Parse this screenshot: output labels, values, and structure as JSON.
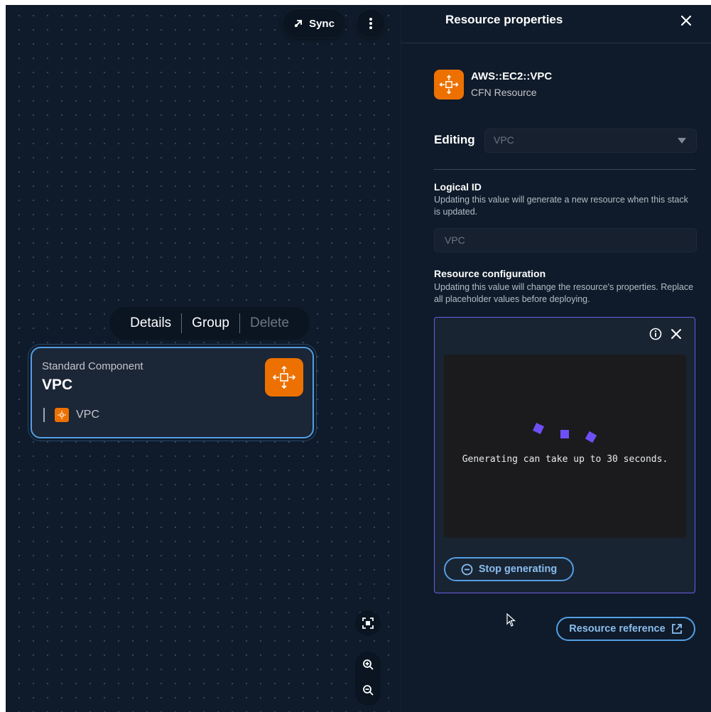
{
  "canvas": {
    "sync_label": "Sync",
    "context_menu": {
      "details": "Details",
      "group": "Group",
      "delete": "Delete"
    },
    "node": {
      "kind": "Standard Component",
      "name": "VPC",
      "sub_resource": "VPC"
    }
  },
  "panel": {
    "title": "Resource properties",
    "resource_type": "AWS::EC2::VPC",
    "resource_subtitle": "CFN Resource",
    "editing_label": "Editing",
    "editing_value": "VPC",
    "logical_id": {
      "title": "Logical ID",
      "description": "Updating this value will generate a new resource when this stack is updated.",
      "value": "VPC"
    },
    "resource_config": {
      "title": "Resource configuration",
      "description": "Updating this value will change the resource's properties. Replace all placeholder values before deploying."
    },
    "generator": {
      "message": "Generating can take up to 30 seconds.",
      "stop_label": "Stop generating"
    },
    "reference_label": "Resource reference"
  },
  "colors": {
    "background": "#0f1b2a",
    "accent_blue": "#539fe5",
    "aws_orange": "#ed7100",
    "generator_purple": "#6c5ce7"
  }
}
